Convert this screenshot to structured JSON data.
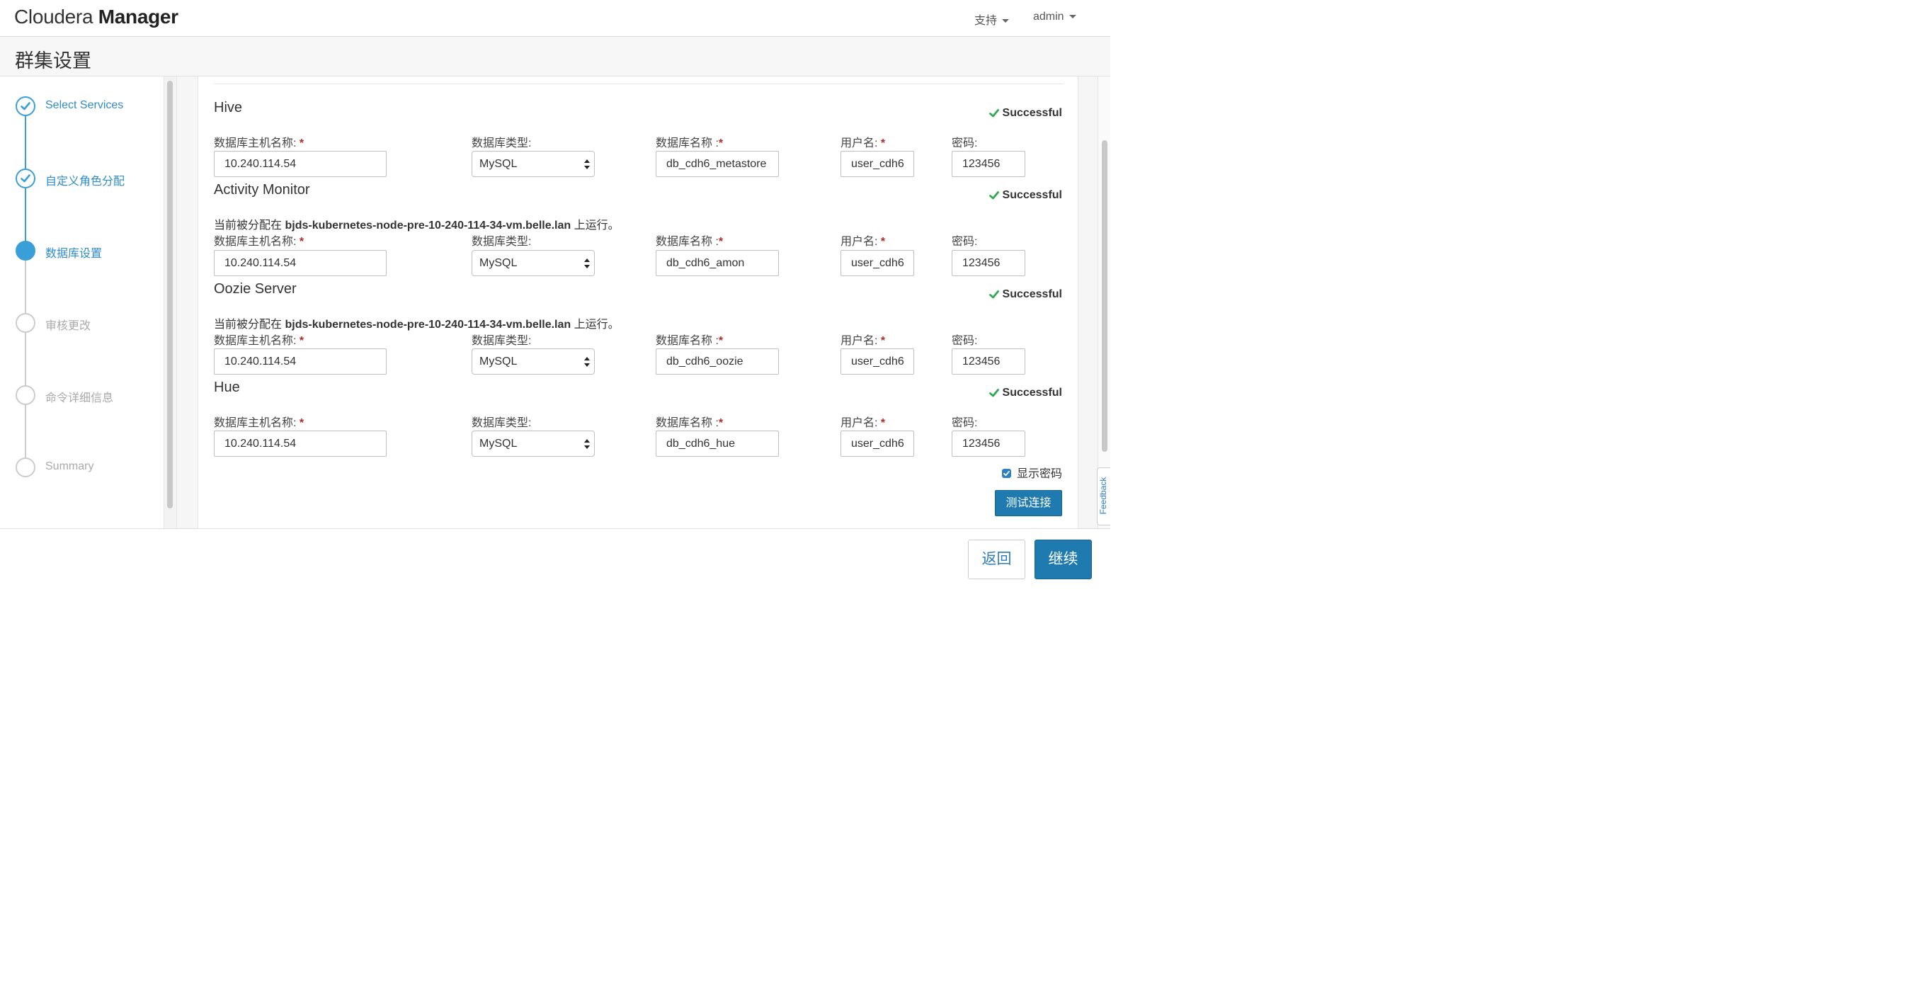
{
  "header": {
    "brand_light": "Cloudera",
    "brand_bold": "Manager",
    "support_menu": "支持",
    "user_menu": "admin"
  },
  "page": {
    "title": "群集设置"
  },
  "steps": [
    {
      "label": "Select Services",
      "state": "done"
    },
    {
      "label": "自定义角色分配",
      "state": "done"
    },
    {
      "label": "数据库设置",
      "state": "active"
    },
    {
      "label": "审核更改",
      "state": "pending"
    },
    {
      "label": "命令详细信息",
      "state": "pending"
    },
    {
      "label": "Summary",
      "state": "pending"
    }
  ],
  "labels": {
    "host": "数据库主机名称:",
    "type": "数据库类型:",
    "name": "数据库名称 :",
    "user": "用户名:",
    "password": "密码:",
    "required": "*",
    "status": "Successful",
    "assign_prefix": "当前被分配在",
    "assign_suffix": "上运行。"
  },
  "services": [
    {
      "name": "Hive",
      "host": "10.240.114.54",
      "db_type": "MySQL",
      "db_name": "db_cdh6_metastore",
      "user": "user_cdh6",
      "password": "123456"
    },
    {
      "name": "Activity Monitor",
      "assigned_host": "bjds-kubernetes-node-pre-10-240-114-34-vm.belle.lan",
      "host": "10.240.114.54",
      "db_type": "MySQL",
      "db_name": "db_cdh6_amon",
      "user": "user_cdh6",
      "password": "123456"
    },
    {
      "name": "Oozie Server",
      "assigned_host": "bjds-kubernetes-node-pre-10-240-114-34-vm.belle.lan",
      "host": "10.240.114.54",
      "db_type": "MySQL",
      "db_name": "db_cdh6_oozie",
      "user": "user_cdh6",
      "password": "123456"
    },
    {
      "name": "Hue",
      "host": "10.240.114.54",
      "db_type": "MySQL",
      "db_name": "db_cdh6_hue",
      "user": "user_cdh6",
      "password": "123456"
    }
  ],
  "show_password": {
    "label": "显示密码",
    "checked": true
  },
  "buttons": {
    "test_connection": "测试连接",
    "back": "返回",
    "continue": "继续",
    "feedback": "Feedback"
  },
  "colors": {
    "accent": "#3a9ed8",
    "primary_button": "#1f7ab0",
    "success_check": "#2fa84f",
    "required": "#b02a2a"
  }
}
